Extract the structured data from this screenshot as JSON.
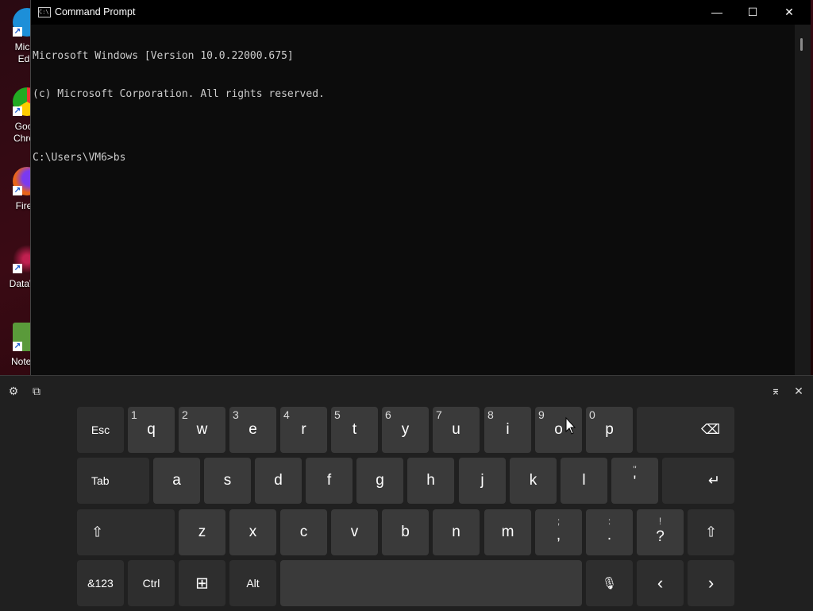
{
  "desktop_icons": [
    {
      "name": "edge",
      "label": "Micr\nEd",
      "color": "#1d8fd8"
    },
    {
      "name": "chrome",
      "label": "Goo\nChro",
      "color": "#3c8cf0"
    },
    {
      "name": "firefox",
      "label": "Fire",
      "color": "#e8641a"
    },
    {
      "name": "datawrangler",
      "label": "DataW",
      "color": "#a01840"
    },
    {
      "name": "notepad",
      "label": "Notep",
      "color": "#5a9a3a"
    }
  ],
  "window": {
    "icon_text": "C:\\",
    "title": "Command Prompt",
    "minimize": "—",
    "maximize": "☐",
    "close": "✕"
  },
  "console": {
    "lines": [
      "Microsoft Windows [Version 10.0.22000.675]",
      "(c) Microsoft Corporation. All rights reserved.",
      "",
      "C:\\Users\\VM6>bs"
    ]
  },
  "keyboard": {
    "toolbar": {
      "settings": "⚙",
      "dock": "⧉",
      "pin": "⌆",
      "close": "✕"
    },
    "row1": {
      "esc": "Esc",
      "keys": [
        {
          "num": "1",
          "ch": "q"
        },
        {
          "num": "2",
          "ch": "w"
        },
        {
          "num": "3",
          "ch": "e"
        },
        {
          "num": "4",
          "ch": "r"
        },
        {
          "num": "5",
          "ch": "t"
        },
        {
          "num": "6",
          "ch": "y"
        },
        {
          "num": "7",
          "ch": "u"
        },
        {
          "num": "8",
          "ch": "i"
        },
        {
          "num": "9",
          "ch": "o"
        },
        {
          "num": "0",
          "ch": "p"
        }
      ],
      "backspace": "⌫"
    },
    "row2": {
      "tab": "Tab",
      "keys": [
        "a",
        "s",
        "d",
        "f",
        "g",
        "h",
        "j",
        "k",
        "l"
      ],
      "quote": {
        "top": "\"",
        "bottom": "'"
      },
      "enter": "↵"
    },
    "row3": {
      "shift": "⇧",
      "keys": [
        "z",
        "x",
        "c",
        "v",
        "b",
        "n",
        "m"
      ],
      "comma": {
        "top": ";",
        "bottom": ","
      },
      "period": {
        "top": ":",
        "bottom": "."
      },
      "question": {
        "top": "!",
        "bottom": "?"
      },
      "shift_right": "⇧"
    },
    "row4": {
      "sym": "&123",
      "ctrl": "Ctrl",
      "win": "⊞",
      "alt": "Alt",
      "space": "",
      "mic": "🎙",
      "left": "‹",
      "right": "›"
    }
  }
}
